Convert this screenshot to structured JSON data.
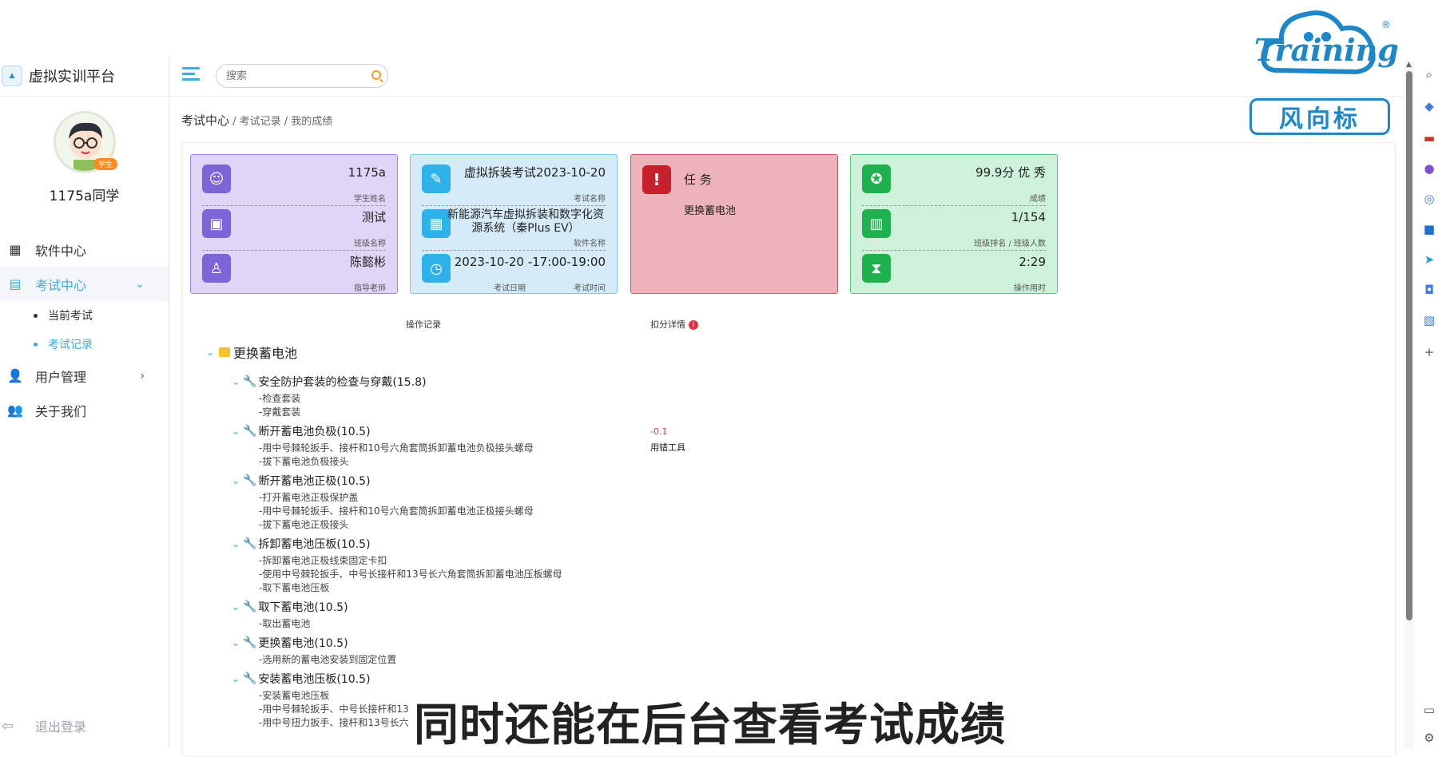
{
  "app": {
    "title": "虚拟实训平台",
    "logo_text": "Training"
  },
  "profile": {
    "role_badge": "学生",
    "name": "1175a同学"
  },
  "nav": {
    "items": [
      {
        "label": "软件中心",
        "icon": "grid-icon"
      },
      {
        "label": "考试中心",
        "icon": "exam-icon",
        "expanded": true
      },
      {
        "label": "用户管理",
        "icon": "user-manage-icon"
      },
      {
        "label": "关于我们",
        "icon": "about-icon"
      }
    ],
    "sub_items": [
      {
        "label": "当前考试"
      },
      {
        "label": "考试记录",
        "active": true
      }
    ],
    "logout": "退出登录"
  },
  "search": {
    "placeholder": "搜索",
    "value": ""
  },
  "breadcrumb": {
    "root": "考试中心",
    "rest": " / 考试记录 / 我的成绩"
  },
  "cards": {
    "student": {
      "name_value": "1175a",
      "name_label": "学生姓名",
      "class_value": "测试",
      "class_label": "班级名称",
      "teacher_value": "陈懿彬",
      "teacher_label": "指导老师"
    },
    "exam": {
      "exam_value": "虚拟拆装考试2023-10-20",
      "exam_label": "考试名称",
      "software_value": "新能源汽车虚拟拆装和数字化资源系统（秦Plus EV）",
      "software_label": "软件名称",
      "datetime_value": "2023-10-20 -17:00-19:00",
      "date_label": "考试日期",
      "time_label": "考试时间"
    },
    "task": {
      "title": "任 务",
      "value": "更换蓄电池"
    },
    "result": {
      "score_value": "99.9分 优 秀",
      "score_label": "成绩",
      "rank_value": "1/154",
      "rank_label": "班级排名 / 班级人数",
      "duration_value": "2:29",
      "duration_label": "操作用时"
    }
  },
  "sections": {
    "records": "操作记录",
    "deductions": "扣分详情",
    "deduct_icon": "i"
  },
  "tree": {
    "root": "更换蓄电池",
    "steps": [
      {
        "title": "安全防护套装的检查与穿戴(15.8)",
        "subs": [
          "-检查套装",
          "-穿戴套装"
        ]
      },
      {
        "title": "断开蓄电池负极(10.5)",
        "subs": [
          "-用中号棘轮扳手、接杆和10号六角套筒拆卸蓄电池负极接头螺母",
          "-拔下蓄电池负极接头"
        ],
        "deduct_score": "-0.1",
        "deduct_reason": "用错工具"
      },
      {
        "title": "断开蓄电池正极(10.5)",
        "subs": [
          "-打开蓄电池正极保护盖",
          "-用中号棘轮扳手、接杆和10号六角套筒拆卸蓄电池正极接头螺母",
          "-拔下蓄电池正极接头"
        ]
      },
      {
        "title": "拆卸蓄电池压板(10.5)",
        "subs": [
          "-拆卸蓄电池正极线束固定卡扣",
          "-使用中号棘轮扳手、中号长接杆和13号长六角套筒拆卸蓄电池压板螺母",
          "-取下蓄电池压板"
        ]
      },
      {
        "title": "取下蓄电池(10.5)",
        "subs": [
          "-取出蓄电池"
        ]
      },
      {
        "title": "更换蓄电池(10.5)",
        "subs": [
          "-选用新的蓄电池安装到固定位置"
        ]
      },
      {
        "title": "安装蓄电池压板(10.5)",
        "subs": [
          "-安装蓄电池压板",
          "-用中号棘轮扳手、中号长接杆和13",
          "-用中号扭力扳手、接杆和13号长六"
        ]
      }
    ]
  },
  "caption": "同时还能在后台查看考试成绩",
  "watermark": {
    "brand_en": "Training",
    "brand_cn": "风向标",
    "registered": "®"
  },
  "colors": {
    "accent": "#3fa9e0",
    "purple": "#7d64d8",
    "blue": "#2fb2ea",
    "red": "#c6202d",
    "green": "#1fb04f"
  }
}
